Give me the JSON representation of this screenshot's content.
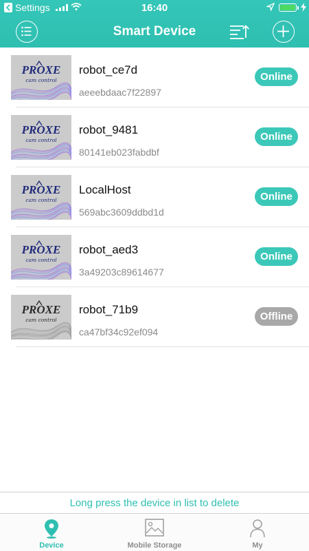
{
  "status_bar": {
    "carrier": "Settings",
    "time": "16:40"
  },
  "header": {
    "title": "Smart Device"
  },
  "colors": {
    "accent": "#2fbfb1",
    "online": "#3cc8b8",
    "offline": "#a8a8a8"
  },
  "devices": [
    {
      "name": "robot_ce7d",
      "id": "aeeebdaac7f22897",
      "status": "Online",
      "logo_text": "PROXE",
      "logo_sub": "cam control"
    },
    {
      "name": "robot_9481",
      "id": "80141eb023fabdbf",
      "status": "Online",
      "logo_text": "PROXE",
      "logo_sub": "cam control"
    },
    {
      "name": "LocalHost",
      "id": "569abc3609ddbd1d",
      "status": "Online",
      "logo_text": "PROXE",
      "logo_sub": "cam control"
    },
    {
      "name": "robot_aed3",
      "id": "3a49203c89614677",
      "status": "Online",
      "logo_text": "PROXE",
      "logo_sub": "cam control"
    },
    {
      "name": "robot_71b9",
      "id": "ca47bf34c92ef094",
      "status": "Offline",
      "logo_text": "PROXE",
      "logo_sub": "cam control"
    }
  ],
  "hint": "Long press the device in list to delete",
  "tabs": [
    {
      "label": "Device",
      "icon": "device-location-icon",
      "active": true
    },
    {
      "label": "Mobile Storage",
      "icon": "image-gallery-icon",
      "active": false
    },
    {
      "label": "My",
      "icon": "person-icon",
      "active": false
    }
  ]
}
